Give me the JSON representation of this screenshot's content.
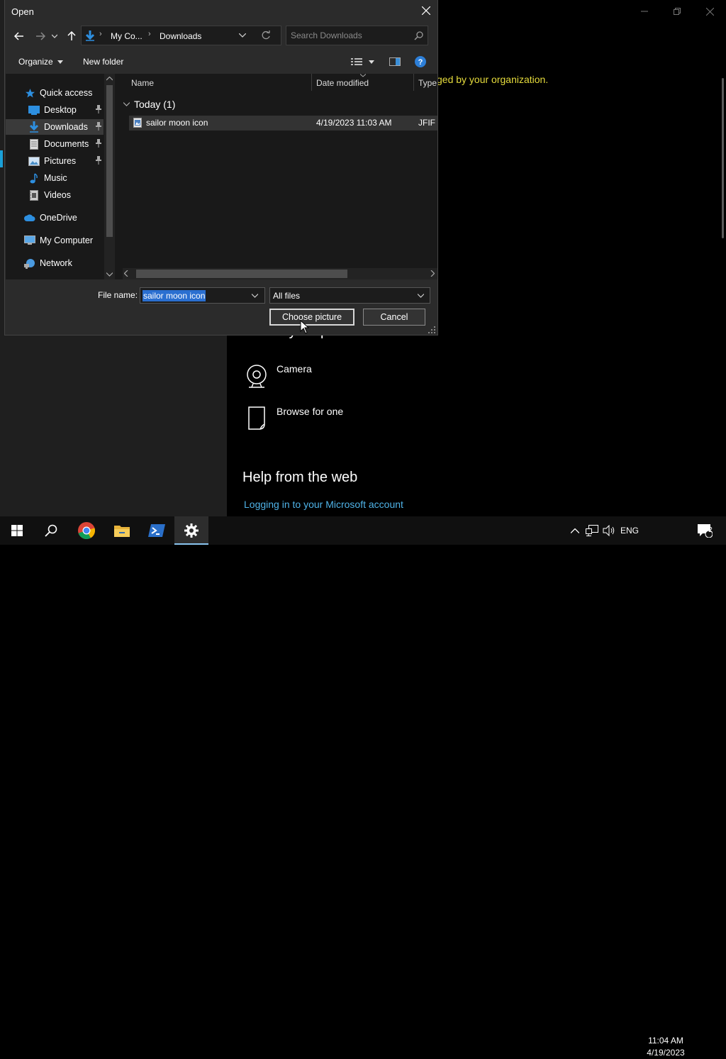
{
  "settings": {
    "managed_text": "ged by your organization.",
    "create_heading": "Create your picture",
    "camera_label": "Camera",
    "browse_label": "Browse for one",
    "help_heading": "Help from the web",
    "help_link": "Logging in to your Microsoft account"
  },
  "dialog": {
    "title": "Open",
    "breadcrumb": [
      "My Co...",
      "Downloads"
    ],
    "search_placeholder": "Search Downloads",
    "toolbar": {
      "organize": "Organize",
      "new_folder": "New folder"
    },
    "nav": {
      "quick_access": "Quick access",
      "desktop": "Desktop",
      "downloads": "Downloads",
      "documents": "Documents",
      "pictures": "Pictures",
      "music": "Music",
      "videos": "Videos",
      "onedrive": "OneDrive",
      "my_computer": "My Computer",
      "network": "Network"
    },
    "columns": {
      "name": "Name",
      "date": "Date modified",
      "type": "Type"
    },
    "group": "Today (1)",
    "file": {
      "name": "sailor moon icon",
      "date": "4/19/2023 11:03 AM",
      "type": "JFIF F"
    },
    "filename_label": "File name:",
    "filename_value": "sailor moon icon",
    "filetype_value": "All files",
    "choose_button": "Choose picture",
    "cancel_button": "Cancel"
  },
  "taskbar": {
    "language": "ENG",
    "time": "11:04 AM",
    "date": "4/19/2023",
    "notification_count": "2"
  },
  "colors": {
    "accent": "#1aa0d8",
    "managed": "#e6dc3c",
    "link": "#4fb3e8",
    "selection": "#2a6fd0"
  }
}
